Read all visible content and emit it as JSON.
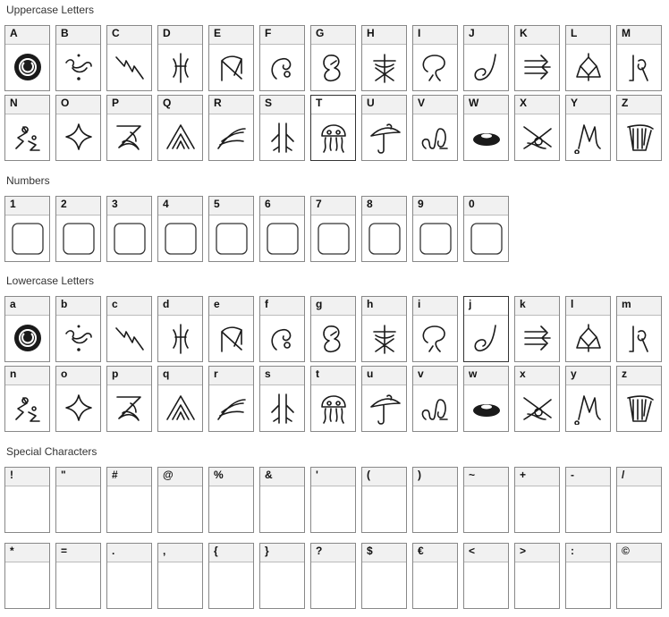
{
  "sections": [
    {
      "title": "Uppercase Letters",
      "kind": "glyph",
      "rows": [
        [
          "A",
          "B",
          "C",
          "D",
          "E",
          "F",
          "G",
          "H",
          "I",
          "J",
          "K",
          "L",
          "M"
        ],
        [
          "N",
          "O",
          "P",
          "Q",
          "R",
          "S",
          "T",
          "U",
          "V",
          "W",
          "X",
          "Y",
          "Z"
        ]
      ]
    },
    {
      "title": "Numbers",
      "kind": "box",
      "rows": [
        [
          "1",
          "2",
          "3",
          "4",
          "5",
          "6",
          "7",
          "8",
          "9",
          "0"
        ]
      ]
    },
    {
      "title": "Lowercase Letters",
      "kind": "glyph",
      "rows": [
        [
          "a",
          "b",
          "c",
          "d",
          "e",
          "f",
          "g",
          "h",
          "i",
          "j",
          "k",
          "l",
          "m"
        ],
        [
          "n",
          "o",
          "p",
          "q",
          "r",
          "s",
          "t",
          "u",
          "v",
          "w",
          "x",
          "y",
          "z"
        ]
      ]
    },
    {
      "title": "Special Characters",
      "kind": "empty",
      "rows": [
        [
          "!",
          "\"",
          "#",
          "@",
          "%",
          "&",
          "'",
          "(",
          ")",
          "~",
          "+",
          "-",
          "/"
        ],
        [
          "*",
          "=",
          ".",
          ",",
          "{",
          "}",
          "?",
          "$",
          "€",
          "<",
          ">",
          ":",
          "©"
        ]
      ]
    }
  ],
  "glyph_icons": [
    "moon-seal-icon",
    "curl-drop-icon",
    "lightning-zigzag-icon",
    "antenna-fork-icon",
    "flag-arch-icon",
    "spiral-hook-icon",
    "bubble-hook-icon",
    "crossed-tree-icon",
    "cloud-hook-icon",
    "spiral-j-icon",
    "triple-arrow-icon",
    "lantern-diamond-icon",
    "curl-pillar-icon",
    "zigzag-curl-icon",
    "four-point-star-icon",
    "z-swoosh-icon",
    "tent-lines-icon",
    "feather-swoosh-icon",
    "split-pillar-icon",
    "jellyfish-icon",
    "mushroom-curl-icon",
    "loop-knot-icon",
    "ring-disc-icon",
    "crossing-strokes-icon",
    "m-hook-icon",
    "harp-icon"
  ]
}
